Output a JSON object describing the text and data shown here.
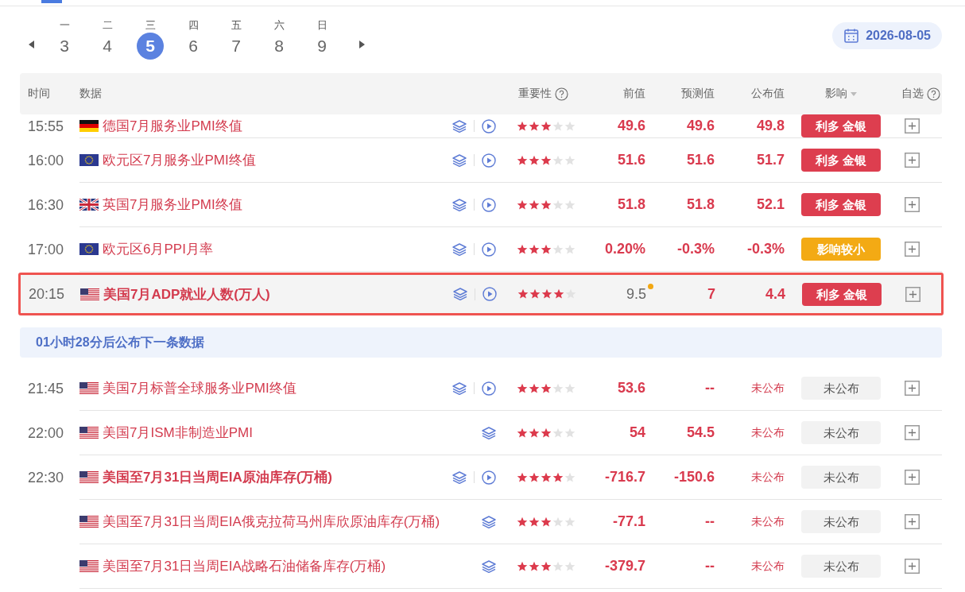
{
  "week": {
    "days": [
      {
        "weekday": "一",
        "day": "3",
        "selected": false
      },
      {
        "weekday": "二",
        "day": "4",
        "selected": false
      },
      {
        "weekday": "三",
        "day": "5",
        "selected": true
      },
      {
        "weekday": "四",
        "day": "6",
        "selected": false
      },
      {
        "weekday": "五",
        "day": "7",
        "selected": false
      },
      {
        "weekday": "六",
        "day": "8",
        "selected": false
      },
      {
        "weekday": "日",
        "day": "9",
        "selected": false
      }
    ],
    "date": "2026-08-05"
  },
  "table": {
    "columns": [
      "时间",
      "数据",
      "重要性",
      "前值",
      "预测值",
      "公布值",
      "影响",
      "自选"
    ],
    "groups": [
      {
        "rows": [
          {
            "time": "15:55",
            "flag": {
              "kind": "de"
            },
            "name": "德国7月服务业PMI终值",
            "bold": false,
            "highlighted": false,
            "chart": true,
            "video": true,
            "stars": 3,
            "previous": "49.6",
            "revised": false,
            "forecast": "49.6",
            "actual": "49.8",
            "released": true,
            "impact": {
              "text": "利多 金银",
              "kind": "bullish"
            }
          },
          {
            "time": "16:00",
            "flag": {
              "kind": "eu"
            },
            "name": "欧元区7月服务业PMI终值",
            "bold": false,
            "highlighted": false,
            "chart": true,
            "video": true,
            "stars": 3,
            "previous": "51.6",
            "revised": false,
            "forecast": "51.6",
            "actual": "51.7",
            "released": true,
            "impact": {
              "text": "利多 金银",
              "kind": "bullish"
            }
          },
          {
            "time": "16:30",
            "flag": {
              "kind": "uk"
            },
            "name": "英国7月服务业PMI终值",
            "bold": false,
            "highlighted": false,
            "chart": true,
            "video": true,
            "stars": 3,
            "previous": "51.8",
            "revised": false,
            "forecast": "51.8",
            "actual": "52.1",
            "released": true,
            "impact": {
              "text": "利多 金银",
              "kind": "bullish"
            }
          },
          {
            "time": "17:00",
            "flag": {
              "kind": "eu"
            },
            "name": "欧元区6月PPI月率",
            "bold": false,
            "highlighted": false,
            "chart": true,
            "video": true,
            "stars": 3,
            "previous": "0.20%",
            "revised": false,
            "forecast": "-0.3%",
            "actual": "-0.3%",
            "released": true,
            "impact": {
              "text": "影响较小",
              "kind": "minor"
            }
          },
          {
            "time": "20:15",
            "flag": {
              "kind": "us"
            },
            "name": "美国7月ADP就业人数(万人)",
            "bold": true,
            "highlighted": true,
            "chart": true,
            "video": true,
            "stars": 4,
            "previous": "9.5",
            "revised": true,
            "forecast": "7",
            "actual": "4.4",
            "released": true,
            "impact": {
              "text": "利多 金银",
              "kind": "bullish"
            }
          }
        ]
      },
      {
        "banner": "01小时28分后公布下一条数据",
        "rows": [
          {
            "time": "21:45",
            "flag": {
              "kind": "us"
            },
            "name": "美国7月标普全球服务业PMI终值",
            "bold": false,
            "highlighted": false,
            "chart": true,
            "video": true,
            "stars": 3,
            "previous": "53.6",
            "revised": false,
            "forecast": "--",
            "actual": "未公布",
            "released": false,
            "impact": {
              "text": "未公布",
              "kind": "pending"
            }
          },
          {
            "time": "22:00",
            "flag": {
              "kind": "us"
            },
            "name": "美国7月ISM非制造业PMI",
            "bold": false,
            "highlighted": false,
            "chart": true,
            "video": false,
            "stars": 3,
            "previous": "54",
            "revised": false,
            "forecast": "54.5",
            "actual": "未公布",
            "released": false,
            "impact": {
              "text": "未公布",
              "kind": "pending"
            }
          },
          {
            "time": "22:30",
            "flag": {
              "kind": "us"
            },
            "name": "美国至7月31日当周EIA原油库存(万桶)",
            "bold": true,
            "highlighted": false,
            "chart": true,
            "video": true,
            "stars": 4,
            "previous": "-716.7",
            "revised": false,
            "forecast": "-150.6",
            "actual": "未公布",
            "released": false,
            "impact": {
              "text": "未公布",
              "kind": "pending"
            }
          },
          {
            "flag": {
              "kind": "us"
            },
            "name": "美国至7月31日当周EIA俄克拉荷马州库欣原油库存(万桶)",
            "bold": false,
            "highlighted": false,
            "chart": true,
            "video": false,
            "stars": 3,
            "previous": "-77.1",
            "revised": false,
            "forecast": "--",
            "actual": "未公布",
            "released": false,
            "impact": {
              "text": "未公布",
              "kind": "pending"
            }
          },
          {
            "flag": {
              "kind": "us"
            },
            "name": "美国至7月31日当周EIA战略石油储备库存(万桶)",
            "bold": false,
            "highlighted": false,
            "chart": true,
            "video": false,
            "stars": 3,
            "previous": "-379.7",
            "revised": false,
            "forecast": "--",
            "actual": "未公布",
            "released": false,
            "impact": {
              "text": "未公布",
              "kind": "pending"
            }
          }
        ]
      }
    ]
  }
}
